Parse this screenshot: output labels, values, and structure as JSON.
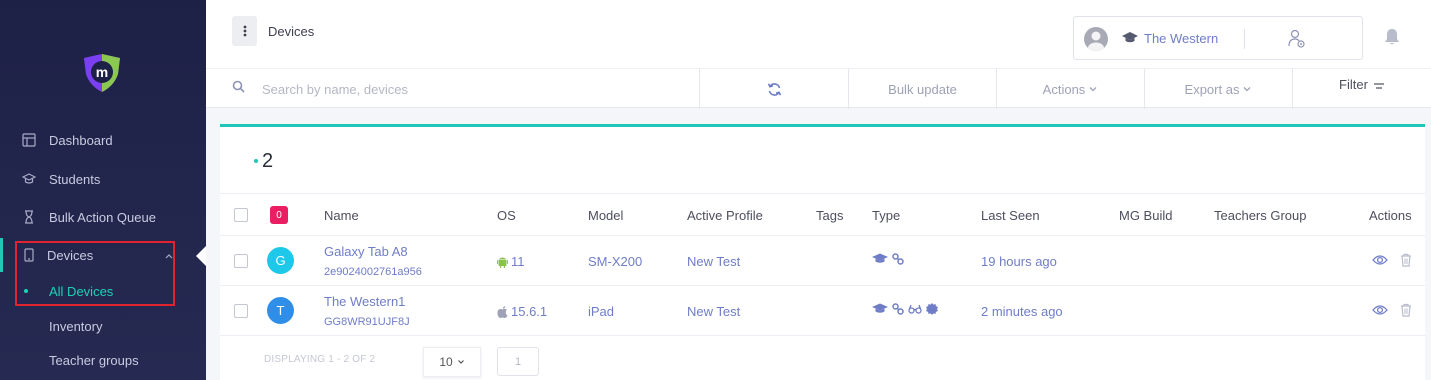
{
  "sidebar": {
    "items": [
      {
        "label": "Dashboard",
        "icon": "dashboard-icon"
      },
      {
        "label": "Students",
        "icon": "graduation-cap-icon"
      },
      {
        "label": "Bulk Action Queue",
        "icon": "hourglass-icon"
      },
      {
        "label": "Devices",
        "icon": "tablet-icon"
      },
      {
        "label": "All Devices"
      },
      {
        "label": "Inventory"
      },
      {
        "label": "Teacher groups"
      }
    ]
  },
  "header": {
    "breadcrumb": "Devices",
    "school_name": "The Western"
  },
  "toolbar": {
    "search_placeholder": "Search by name, devices",
    "bulk_update": "Bulk update",
    "actions": "Actions",
    "export_as": "Export as",
    "filter": "Filter"
  },
  "table": {
    "count": "2",
    "selected_badge": "0",
    "columns": [
      "Name",
      "OS",
      "Model",
      "Active Profile",
      "Tags",
      "Type",
      "Last Seen",
      "MG Build",
      "Teachers Group",
      "Actions"
    ],
    "rows": [
      {
        "initial": "G",
        "avatar_color": "#1ec8e8",
        "name": "Galaxy Tab A8",
        "serial": "2e9024002761a956",
        "os_icon": "android-icon",
        "os": "11",
        "model": "SM-X200",
        "profile": "New Test",
        "tags": "",
        "last_seen": "19 hours ago",
        "build": "",
        "teachers_group": ""
      },
      {
        "initial": "T",
        "avatar_color": "#2f8fe8",
        "name": "The Western1",
        "serial": "GG8WR91UJF8J",
        "os_icon": "apple-icon",
        "os": "15.6.1",
        "model": "iPad",
        "profile": "New Test",
        "tags": "",
        "last_seen": "2 minutes ago",
        "build": "",
        "teachers_group": ""
      }
    ],
    "footer_text": "DISPLAYING 1 - 2 OF 2",
    "page_size": "10",
    "page": "1"
  },
  "colors": {
    "accent": "#1ec8b8",
    "link": "#6f7dc7",
    "sidebar": "#1e2146",
    "badge": "#e91e63",
    "highlight_box": "#e0232e"
  }
}
